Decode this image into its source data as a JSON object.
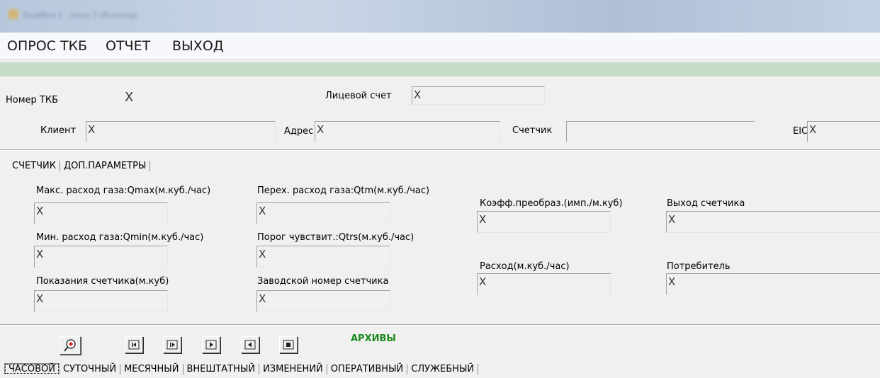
{
  "window": {
    "title": "Ошибка 1 · окно 7 (Running)"
  },
  "menu": {
    "items": [
      "ОПРОС ТКБ",
      "ОТЧЕТ",
      "ВЫХОД"
    ]
  },
  "header": {
    "tkb_label": "Номер ТКБ",
    "tkb_value": "X",
    "account_label": "Лицевой счет",
    "account_value": "X",
    "client_label": "Клиент",
    "client_value": "X",
    "address_label": "Адрес",
    "address_value": "X",
    "meter_label": "Счетчик",
    "meter_value": "",
    "eic_label": "EIC",
    "eic_value": "X"
  },
  "tabs": {
    "items": [
      "СЧЕТЧИК",
      "ДОП.ПАРАМЕТРЫ"
    ],
    "active": "СЧЕТЧИК"
  },
  "params": [
    {
      "label": "Макс. расход газа:Qmax(м.куб./час)",
      "value": "X"
    },
    {
      "label": "Мин. расход газа:Qmin(м.куб./час)",
      "value": "X"
    },
    {
      "label": "Показания счетчика(м.куб)",
      "value": "X"
    },
    {
      "label": "Перех. расход газа:Qtm(м.куб./час)",
      "value": "X"
    },
    {
      "label": "Порог чувствит.:Qtrs(м.куб./час)",
      "value": "X"
    },
    {
      "label": "Заводской номер счетчика",
      "value": "X"
    },
    {
      "label": "Коэфф.преобраз.(имп./м.куб)",
      "value": "X"
    },
    {
      "label": "Расход(м.куб./час)",
      "value": "X"
    },
    {
      "label": "Выход счетчика",
      "value": "X"
    },
    {
      "label": "Потребитель",
      "value": "X"
    }
  ],
  "toolbar": {
    "archive_label": "АРХИВЫ",
    "icons": [
      "zoom-in-icon",
      "first-record-icon",
      "next-record-icon",
      "play-icon",
      "back-icon",
      "stop-icon"
    ]
  },
  "archive_tabs": {
    "items": [
      "ЧАСОВОЙ",
      "СУТОЧНЫЙ",
      "МЕСЯЧНЫЙ",
      "ВНЕШТАТНЫЙ",
      "ИЗМЕНЕНИЙ",
      "ОПЕРАТИВНЫЙ",
      "СЛУЖЕБНЫЙ"
    ],
    "active": "ЧАСОВОЙ"
  }
}
